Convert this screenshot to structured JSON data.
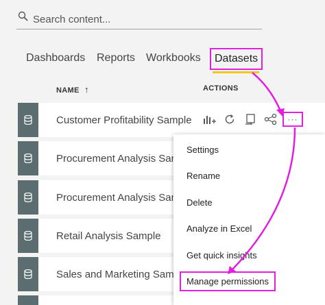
{
  "search": {
    "placeholder": "Search content..."
  },
  "tabs": [
    {
      "label": "Dashboards"
    },
    {
      "label": "Reports"
    },
    {
      "label": "Workbooks"
    },
    {
      "label": "Datasets"
    }
  ],
  "columns": {
    "name": "NAME",
    "actions": "ACTIONS"
  },
  "sort_arrow": "↑",
  "datasets": [
    {
      "name": "Customer Profitability Sample"
    },
    {
      "name": "Procurement Analysis Samp"
    },
    {
      "name": "Procurement Analysis Samp"
    },
    {
      "name": "Retail Analysis Sample"
    },
    {
      "name": "Sales and Marketing Samp"
    }
  ],
  "more_label": "···",
  "menu": [
    {
      "label": "Settings"
    },
    {
      "label": "Rename"
    },
    {
      "label": "Delete"
    },
    {
      "label": "Analyze in Excel"
    },
    {
      "label": "Get quick insights"
    },
    {
      "label": "Manage permissions"
    }
  ],
  "colors": {
    "highlight": "#e21ee0",
    "active_tab_underline": "#f2c811",
    "dataset_icon_bg": "#5b6d6f"
  }
}
